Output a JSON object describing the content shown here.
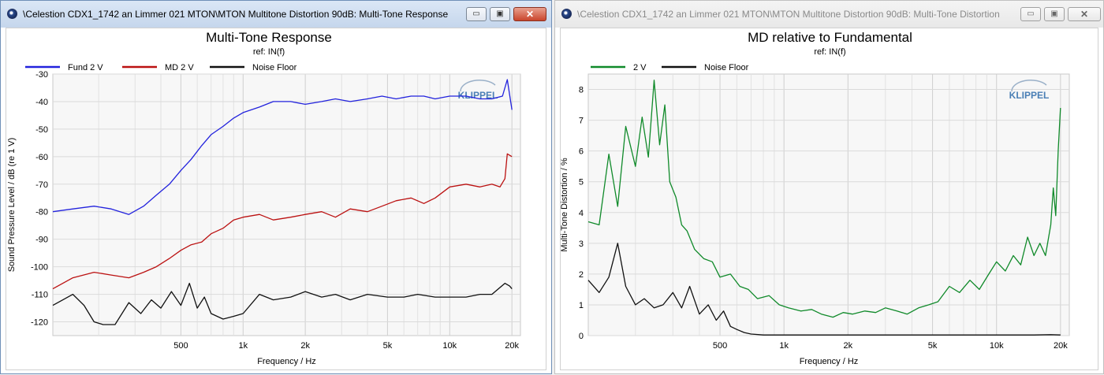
{
  "windows": [
    {
      "title": "\\Celestion CDX1_1742 an Limmer 021 MTON\\MTON Multitone Distortion 90dB: Multi-Tone Response",
      "controls": {
        "minimize": "▭",
        "restore": "▣",
        "close": "✕"
      }
    },
    {
      "title": "\\Celestion CDX1_1742 an Limmer 021 MTON\\MTON Multitone Distortion 90dB: Multi-Tone Distortion",
      "controls": {
        "minimize": "▭",
        "restore": "▣",
        "close": "✕"
      }
    }
  ],
  "chart_data": [
    {
      "type": "line",
      "title": "Multi-Tone Response",
      "subtitle": "ref: IN(f)",
      "xlabel": "Frequency / Hz",
      "ylabel": "Sound Pressure Level / dB (re 1 V)",
      "x_scale": "log",
      "xlim": [
        120,
        22000
      ],
      "ylim": [
        -125,
        -30
      ],
      "x_ticks": [
        500,
        1000,
        2000,
        5000,
        10000,
        20000
      ],
      "x_tick_labels": [
        "500",
        "1k",
        "2k",
        "5k",
        "10k",
        "20k"
      ],
      "y_ticks": [
        -30,
        -40,
        -50,
        -60,
        -70,
        -80,
        -90,
        -100,
        -110,
        -120
      ],
      "y_tick_labels": [
        "-30",
        "-40",
        "-50",
        "-60",
        "-70",
        "-80",
        "-90",
        "-100",
        "-110",
        "-120"
      ],
      "grid": true,
      "legend_position": "top",
      "watermark": "KLIPPEL",
      "series": [
        {
          "name": "Fund 2 V",
          "color": "#2222dd",
          "x": [
            120,
            150,
            190,
            230,
            280,
            330,
            380,
            440,
            500,
            560,
            630,
            700,
            800,
            900,
            1000,
            1200,
            1400,
            1700,
            2000,
            2400,
            2800,
            3300,
            4000,
            4700,
            5500,
            6500,
            7500,
            8500,
            10000,
            12000,
            14000,
            16000,
            18000,
            19000,
            20000
          ],
          "y": [
            -80,
            -79,
            -78,
            -79,
            -81,
            -78,
            -74,
            -70,
            -65,
            -61,
            -56,
            -52,
            -49,
            -46,
            -44,
            -42,
            -40,
            -40,
            -41,
            -40,
            -39,
            -40,
            -39,
            -38,
            -39,
            -38,
            -38,
            -39,
            -38,
            -38,
            -39,
            -39,
            -38,
            -32,
            -43
          ]
        },
        {
          "name": "MD 2 V",
          "color": "#bb1111",
          "x": [
            120,
            150,
            190,
            230,
            280,
            330,
            380,
            440,
            500,
            560,
            630,
            700,
            800,
            900,
            1000,
            1200,
            1400,
            1700,
            2000,
            2400,
            2800,
            3300,
            4000,
            4700,
            5500,
            6500,
            7500,
            8500,
            10000,
            12000,
            14000,
            16000,
            17500,
            18500,
            19000,
            20000
          ],
          "y": [
            -108,
            -104,
            -102,
            -103,
            -104,
            -102,
            -100,
            -97,
            -94,
            -92,
            -91,
            -88,
            -86,
            -83,
            -82,
            -81,
            -83,
            -82,
            -81,
            -80,
            -82,
            -79,
            -80,
            -78,
            -76,
            -75,
            -77,
            -75,
            -71,
            -70,
            -71,
            -70,
            -71,
            -68,
            -59,
            -60
          ]
        },
        {
          "name": "Noise Floor",
          "color": "#111111",
          "x": [
            120,
            150,
            170,
            190,
            210,
            240,
            280,
            320,
            360,
            400,
            450,
            500,
            550,
            600,
            650,
            700,
            800,
            900,
            1000,
            1200,
            1400,
            1700,
            2000,
            2400,
            2800,
            3300,
            4000,
            5000,
            6000,
            7000,
            8500,
            10000,
            12000,
            14000,
            16000,
            18500,
            19500,
            20000
          ],
          "y": [
            -114,
            -110,
            -114,
            -120,
            -121,
            -121,
            -113,
            -117,
            -112,
            -115,
            -109,
            -114,
            -106,
            -115,
            -111,
            -117,
            -119,
            -118,
            -117,
            -110,
            -112,
            -111,
            -109,
            -111,
            -110,
            -112,
            -110,
            -111,
            -111,
            -110,
            -111,
            -111,
            -111,
            -110,
            -110,
            -106,
            -107,
            -108
          ]
        }
      ]
    },
    {
      "type": "line",
      "title": "MD relative to Fundamental",
      "subtitle": "ref: IN(f)",
      "xlabel": "Frequency / Hz",
      "ylabel": "Multi-Tone Distortion / %",
      "x_scale": "log",
      "xlim": [
        120,
        22000
      ],
      "ylim": [
        0,
        8.5
      ],
      "x_ticks": [
        500,
        1000,
        2000,
        5000,
        10000,
        20000
      ],
      "x_tick_labels": [
        "500",
        "1k",
        "2k",
        "5k",
        "10k",
        "20k"
      ],
      "y_ticks": [
        0,
        1,
        2,
        3,
        4,
        5,
        6,
        7,
        8
      ],
      "y_tick_labels": [
        "0",
        "1",
        "2",
        "3",
        "4",
        "5",
        "6",
        "7",
        "8"
      ],
      "grid": true,
      "legend_position": "top",
      "watermark": "KLIPPEL",
      "series": [
        {
          "name": "2 V",
          "color": "#108a2a",
          "x": [
            120,
            135,
            150,
            165,
            180,
            200,
            215,
            230,
            245,
            260,
            275,
            290,
            310,
            330,
            350,
            380,
            420,
            460,
            500,
            560,
            620,
            680,
            750,
            850,
            950,
            1050,
            1200,
            1350,
            1500,
            1700,
            1900,
            2100,
            2400,
            2700,
            3000,
            3400,
            3800,
            4300,
            4800,
            5300,
            6000,
            6700,
            7500,
            8300,
            9200,
            10000,
            11000,
            12000,
            13000,
            14000,
            15000,
            16000,
            17000,
            18000,
            18500,
            19000,
            19500,
            20000
          ],
          "y": [
            3.7,
            3.6,
            5.9,
            4.2,
            6.8,
            5.5,
            7.1,
            5.8,
            8.3,
            6.2,
            7.5,
            5.0,
            4.5,
            3.6,
            3.4,
            2.8,
            2.5,
            2.4,
            1.9,
            2.0,
            1.6,
            1.5,
            1.2,
            1.3,
            1.0,
            0.9,
            0.8,
            0.85,
            0.7,
            0.6,
            0.75,
            0.7,
            0.8,
            0.75,
            0.9,
            0.8,
            0.7,
            0.9,
            1.0,
            1.1,
            1.6,
            1.4,
            1.8,
            1.5,
            2.0,
            2.4,
            2.1,
            2.6,
            2.3,
            3.2,
            2.6,
            3.0,
            2.6,
            3.6,
            4.8,
            3.9,
            6.0,
            7.4
          ]
        },
        {
          "name": "Noise Floor",
          "color": "#111111",
          "x": [
            120,
            135,
            150,
            165,
            180,
            200,
            220,
            245,
            270,
            300,
            330,
            360,
            400,
            440,
            480,
            520,
            560,
            600,
            650,
            700,
            800,
            1000,
            2000,
            5000,
            10000,
            15000,
            18000,
            20000
          ],
          "y": [
            1.8,
            1.4,
            1.9,
            3.0,
            1.6,
            1.0,
            1.2,
            0.9,
            1.0,
            1.4,
            0.9,
            1.6,
            0.7,
            1.0,
            0.5,
            0.8,
            0.3,
            0.2,
            0.1,
            0.05,
            0.02,
            0.02,
            0.02,
            0.02,
            0.02,
            0.02,
            0.03,
            0.02
          ]
        }
      ]
    }
  ]
}
